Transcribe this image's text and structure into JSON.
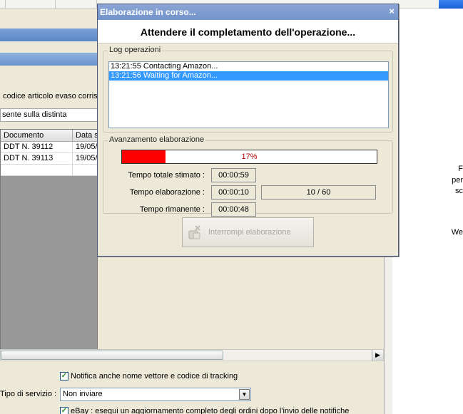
{
  "background": {
    "filter_text_fragment": "codice articolo evaso corrisp",
    "distinta_text": "sente sulla distinta",
    "table": {
      "headers": [
        "Documento",
        "Data s"
      ],
      "rows": [
        [
          "DDT N. 39112",
          "19/05/"
        ],
        [
          "DDT N. 39113",
          "19/05/"
        ]
      ]
    },
    "notify_checkbox_label": "Notifica anche nome vettore e codice di tracking",
    "service_type_label": "Tipo di servizio :",
    "service_type_value": "Non inviare",
    "ebay_checkbox_label": "eBay : esegui un aggiornamento completo degli ordini dopo l'invio delle notifiche",
    "right_panel_texts": [
      "F",
      "per",
      "sc",
      "We"
    ]
  },
  "dialog": {
    "title": "Elaborazione in corso...",
    "banner": "Attendere il completamento dell'operazione...",
    "log_group_title": "Log operazioni",
    "log_lines": [
      {
        "text": "13:21:55 Contacting Amazon...",
        "selected": false
      },
      {
        "text": "13:21:56 Waiting for Amazon...",
        "selected": true
      }
    ],
    "progress_group_title": "Avanzamento elaborazione",
    "progress_percent_label": "17%",
    "progress_value": 0.17,
    "estimated_total_label": "Tempo totale stimato :",
    "estimated_total_value": "00:00:59",
    "elapsed_label": "Tempo elaborazione :",
    "elapsed_value": "00:00:10",
    "count_value": "10 / 60",
    "remaining_label": "Tempo rimanente :",
    "remaining_value": "00:00:48",
    "stop_button_label": "Interrompi elaborazione"
  },
  "colors": {
    "title_bar": "#7a98cd",
    "progress_fill": "#ff0000",
    "selection": "#3399ff"
  }
}
